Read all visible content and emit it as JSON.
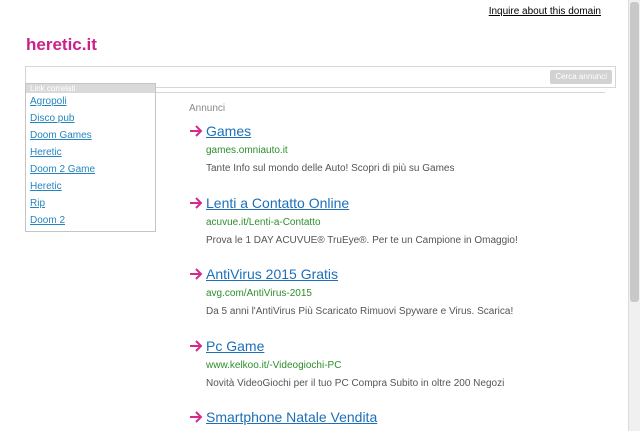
{
  "header": {
    "inquire_link": "Inquire about this domain",
    "site_title": "heretic.it"
  },
  "search": {
    "button_label": "Cerca annunci"
  },
  "related": {
    "header": "Link correlati",
    "links": [
      "Agropoli",
      "Disco pub",
      "Doom Games",
      "Heretic",
      "Doom 2 Game",
      "Heretic",
      "Rip",
      "Doom 2"
    ]
  },
  "ads": {
    "section_label": "Annunci",
    "items": [
      {
        "title": "Games",
        "url": "games.omniauto.it",
        "desc": "Tante Info sul mondo delle Auto! Scopri di più su Games"
      },
      {
        "title": "Lenti a Contatto Online",
        "url": "acuvue.it/Lenti-a-Contatto",
        "desc": "Prova le 1 DAY ACUVUE® TruEye®. Per te un Campione in Omaggio!"
      },
      {
        "title": "AntiVirus 2015 Gratis",
        "url": "avg.com/AntiVirus-2015",
        "desc": "Da 5 anni l'AntiVirus Più Scaricato Rimuovi Spyware e Virus. Scarica!"
      },
      {
        "title": "Pc Game",
        "url": "www.kelkoo.it/-Videogiochi-PC",
        "desc": "Novità VideoGiochi per il tuo PC Compra Subito in oltre 200 Negozi"
      },
      {
        "title": "Smartphone Natale Vendita",
        "url": "",
        "desc": ""
      }
    ]
  },
  "colors": {
    "brand": "#cc1f8a",
    "arrow": "#d42a8c",
    "link": "#1c6fb8",
    "url": "#2c8f2c"
  }
}
